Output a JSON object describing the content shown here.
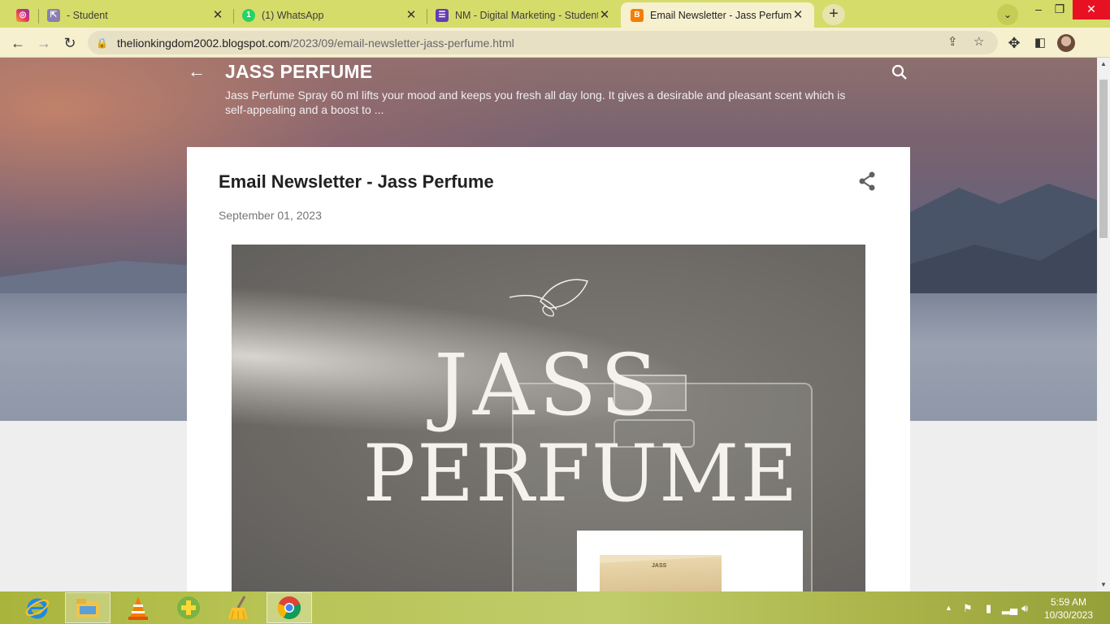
{
  "browser": {
    "tabs": [
      {
        "label": "",
        "icon": "instagram-icon"
      },
      {
        "label": "- Student",
        "icon": "app-icon"
      },
      {
        "label": "(1) WhatsApp",
        "icon": "whatsapp-icon",
        "badge": "1"
      },
      {
        "label": "NM - Digital Marketing - Student",
        "icon": "forms-icon"
      },
      {
        "label": "Email Newsletter - Jass Perfume",
        "icon": "blogger-icon",
        "active": true
      }
    ],
    "url_host": "thelionkingdom2002.blogspot.com",
    "url_path": "/2023/09/email-newsletter-jass-perfume.html"
  },
  "blog": {
    "title": "JASS PERFUME",
    "description": "Jass Perfume Spray 60 ml lifts your mood and keeps you fresh all day long. It gives a desirable and pleasant scent which is self-appealing and a boost to ..."
  },
  "post": {
    "title": "Email Newsletter - Jass Perfume",
    "date": "September 01, 2023",
    "image_text_line1": "JASS",
    "image_text_line2": "PERFUME",
    "box_label": "JASS"
  },
  "taskbar": {
    "apps": [
      "internet-explorer-icon",
      "file-explorer-icon",
      "vlc-icon",
      "add-app-icon",
      "cleaner-icon",
      "chrome-icon"
    ],
    "time": "5:59 AM",
    "date": "10/30/2023"
  },
  "colors": {
    "tabstrip": "#d6dc6a",
    "toolbar": "#f6f0cf",
    "close_button": "#e81123"
  }
}
